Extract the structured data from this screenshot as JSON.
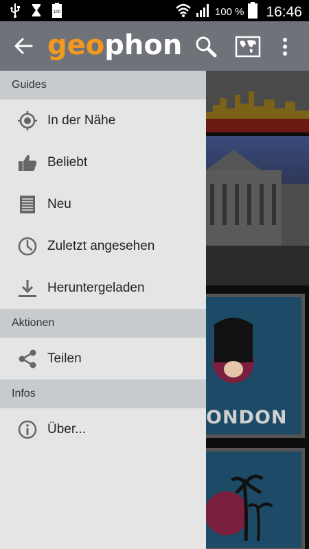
{
  "status_bar": {
    "battery_percent": "100 %",
    "time": "16:46",
    "icons": [
      "usb-icon",
      "hourglass-icon",
      "battery-full-small-icon",
      "wifi-icon",
      "signal-icon",
      "battery-icon"
    ]
  },
  "app_bar": {
    "logo_part1": "geo",
    "logo_part2": "phon",
    "logo_color_accent": "#f39a1e",
    "background_color": "#6f7278",
    "icons": [
      "back-arrow-icon",
      "search-icon",
      "map-icon",
      "overflow-menu-icon"
    ]
  },
  "drawer": {
    "sections": [
      {
        "title": "Guides",
        "items": [
          {
            "label": "In der Nähe",
            "icon": "location-target-icon"
          },
          {
            "label": "Beliebt",
            "icon": "thumbs-up-icon"
          },
          {
            "label": "Neu",
            "icon": "list-document-icon"
          },
          {
            "label": "Zuletzt angesehen",
            "icon": "clock-icon"
          },
          {
            "label": "Heruntergeladen",
            "icon": "download-icon"
          }
        ]
      },
      {
        "title": "Aktionen",
        "items": [
          {
            "label": "Teilen",
            "icon": "share-icon"
          }
        ]
      },
      {
        "title": "Infos",
        "items": [
          {
            "label": "Über...",
            "icon": "info-icon"
          }
        ]
      }
    ]
  },
  "background": {
    "visible_label": "ONDON"
  }
}
